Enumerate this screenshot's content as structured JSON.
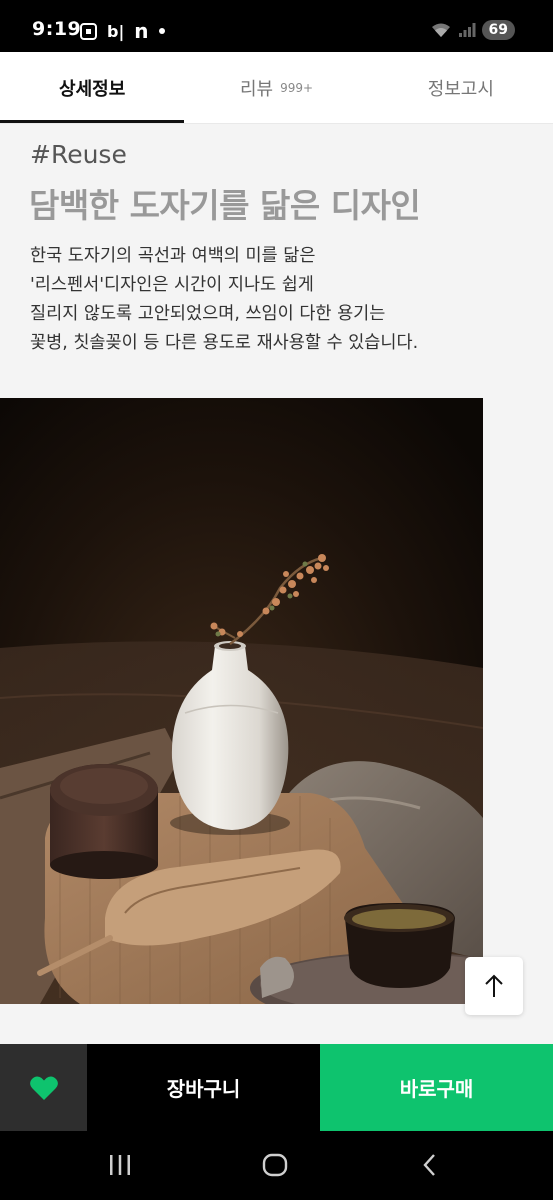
{
  "status_bar": {
    "time": "9:19",
    "app_icons": [
      "screenshot-icon",
      "b-app-icon",
      "naver-icon",
      "notification-dot"
    ],
    "b_label": "b|",
    "n_label": "n",
    "battery": "69"
  },
  "tabs": [
    {
      "label": "상세정보",
      "count": "",
      "active": true
    },
    {
      "label": "리뷰",
      "count": "999+",
      "active": false
    },
    {
      "label": "정보고시",
      "count": "",
      "active": false
    }
  ],
  "content": {
    "hashtag": "#Reuse",
    "headline": "담백한 도자기를 닮은 디자인",
    "description_lines": [
      "한국 도자기의 곡선과 여백의 미를 닮은",
      "'리스펜서'디자인은 시간이 지나도 쉽게",
      "질리지 않도록 고안되었으며, 쓰임이 다한 용기는",
      "꽃병, 칫솔꽂이 등 다른 용도로 재사용할 수 있습니다."
    ]
  },
  "buy_bar": {
    "like_icon": "heart-icon",
    "cart_label": "장바구니",
    "buy_label": "바로구매"
  },
  "colors": {
    "accent_green": "#0ec36e",
    "heart_green": "#0ec36e",
    "cart_bg": "#000000",
    "like_bg": "#2e2e2e"
  },
  "nav_bar": {
    "icons": [
      "recent-apps-icon",
      "home-icon",
      "back-icon"
    ]
  }
}
